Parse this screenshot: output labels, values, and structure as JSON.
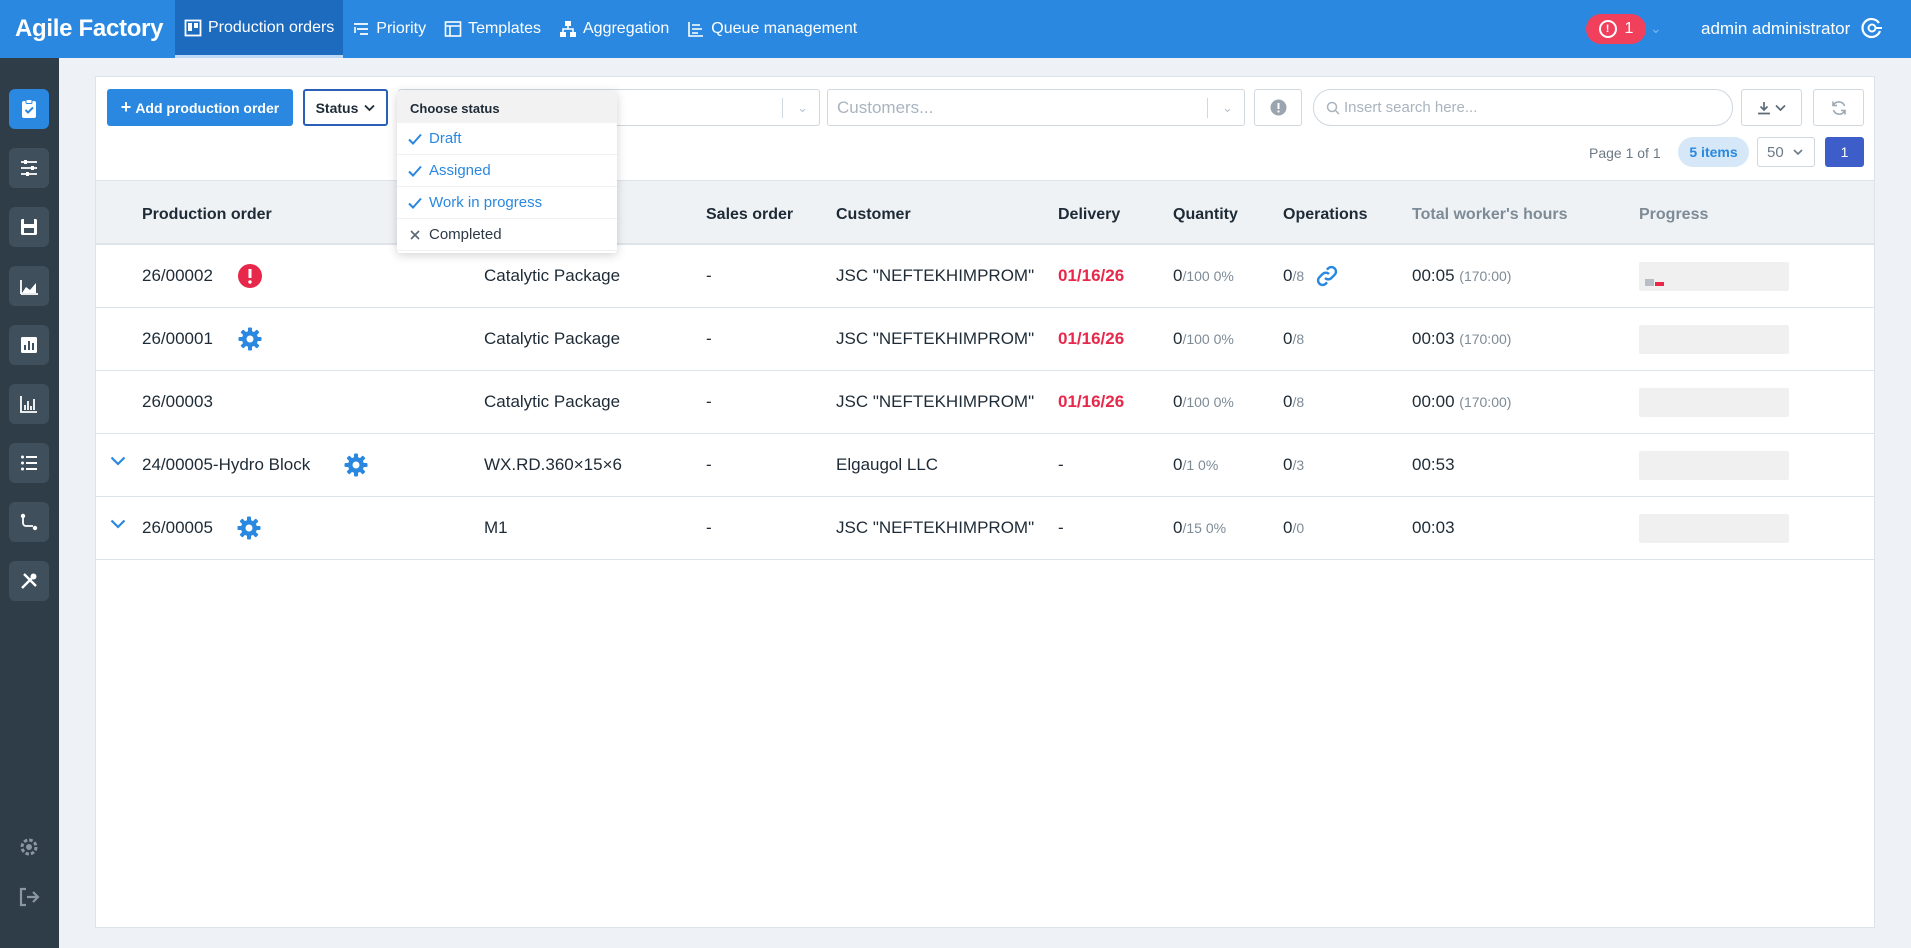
{
  "app": {
    "title": "Agile Factory"
  },
  "nav": {
    "items": [
      {
        "label": "Production orders",
        "icon": "board-icon",
        "active": true
      },
      {
        "label": "Priority",
        "icon": "priority-icon"
      },
      {
        "label": "Templates",
        "icon": "template-icon"
      },
      {
        "label": "Aggregation",
        "icon": "hierarchy-icon"
      },
      {
        "label": "Queue management",
        "icon": "queue-icon"
      }
    ]
  },
  "header": {
    "alerts_count": "1",
    "user_name": "admin administrator"
  },
  "sidebar": {
    "items": [
      "clipboard-check-icon",
      "sliders-icon",
      "save-icon",
      "area-chart-icon",
      "bar-chart-icon",
      "line-chart-icon",
      "list-icon",
      "route-icon",
      "tools-icon"
    ],
    "bottom": [
      "settings-icon",
      "logout-icon"
    ]
  },
  "toolbar": {
    "add_label": "Add production order",
    "status_label": "Status",
    "customers_placeholder": "Customers...",
    "search_placeholder": "Insert search here..."
  },
  "pagination": {
    "page_info": "Page 1 of 1",
    "items_badge": "5 items",
    "per_page": "50",
    "current_page": "1"
  },
  "status_dropdown": {
    "header": "Choose status",
    "options": [
      {
        "label": "Draft",
        "checked": true
      },
      {
        "label": "Assigned",
        "checked": true
      },
      {
        "label": "Work in progress",
        "checked": true
      },
      {
        "label": "Completed",
        "checked": false
      }
    ]
  },
  "table": {
    "columns": {
      "order": "Production order",
      "sales_order": "Sales order",
      "customer": "Customer",
      "delivery": "Delivery",
      "quantity": "Quantity",
      "operations": "Operations",
      "hours": "Total worker's hours",
      "progress": "Progress"
    },
    "rows": [
      {
        "order": "26/00002",
        "product": "Catalytic Package",
        "sales_order": "-",
        "customer": "JSC \"NEFTEKHIMPROM\"",
        "delivery": "01/16/26",
        "qty": "0",
        "qty_of": "/100 0%",
        "ops": "0",
        "ops_of": "/8",
        "hours": "00:05",
        "hours_of": "(170:00)"
      },
      {
        "order": "26/00001",
        "product": "Catalytic Package",
        "sales_order": "-",
        "customer": "JSC \"NEFTEKHIMPROM\"",
        "delivery": "01/16/26",
        "qty": "0",
        "qty_of": "/100 0%",
        "ops": "0",
        "ops_of": "/8",
        "hours": "00:03",
        "hours_of": "(170:00)"
      },
      {
        "order": "26/00003",
        "product": "Catalytic Package",
        "sales_order": "-",
        "customer": "JSC \"NEFTEKHIMPROM\"",
        "delivery": "01/16/26",
        "qty": "0",
        "qty_of": "/100 0%",
        "ops": "0",
        "ops_of": "/8",
        "hours": "00:00",
        "hours_of": "(170:00)"
      },
      {
        "order": "24/00005-Hydro Block",
        "product": "WX.RD.360×15×6",
        "sales_order": "-",
        "customer": "Elgaugol LLC",
        "delivery": "-",
        "qty": "0",
        "qty_of": "/1 0%",
        "ops": "0",
        "ops_of": "/3",
        "hours": "00:53",
        "hours_of": ""
      },
      {
        "order": "26/00005",
        "product": "M1",
        "sales_order": "-",
        "customer": "JSC \"NEFTEKHIMPROM\"",
        "delivery": "-",
        "qty": "0",
        "qty_of": "/15 0%",
        "ops": "0",
        "ops_of": "/0",
        "hours": "00:03",
        "hours_of": ""
      }
    ]
  },
  "colors": {
    "primary": "#2a88e0",
    "danger": "#e8284a",
    "sidebar": "#2f3d48"
  }
}
